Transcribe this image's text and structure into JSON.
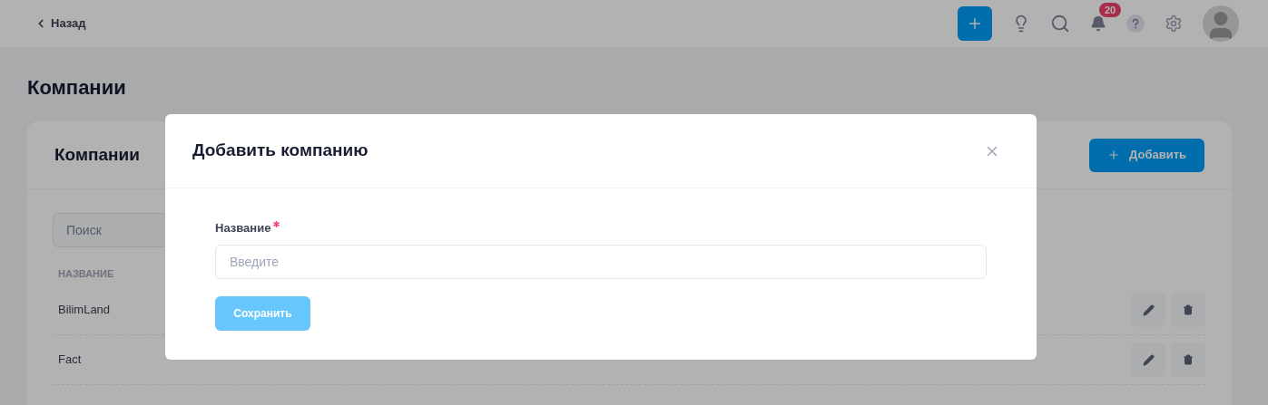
{
  "topbar": {
    "back_link": "Назад",
    "notifications_count": "20"
  },
  "page_title": "Компании",
  "card": {
    "title": "Компании",
    "add_button": "Добавить",
    "search": {
      "placeholder": "Поиск"
    },
    "table": {
      "columns": [
        "НАЗВАНИЕ"
      ],
      "rows": [
        {
          "name": "BilimLand"
        },
        {
          "name": "Fact"
        }
      ]
    }
  },
  "modal": {
    "title": "Добавить компанию",
    "field": {
      "label": "Название",
      "required": true,
      "placeholder": "Введите"
    },
    "save_button": {
      "label": "Сохранить",
      "disabled": true
    }
  }
}
